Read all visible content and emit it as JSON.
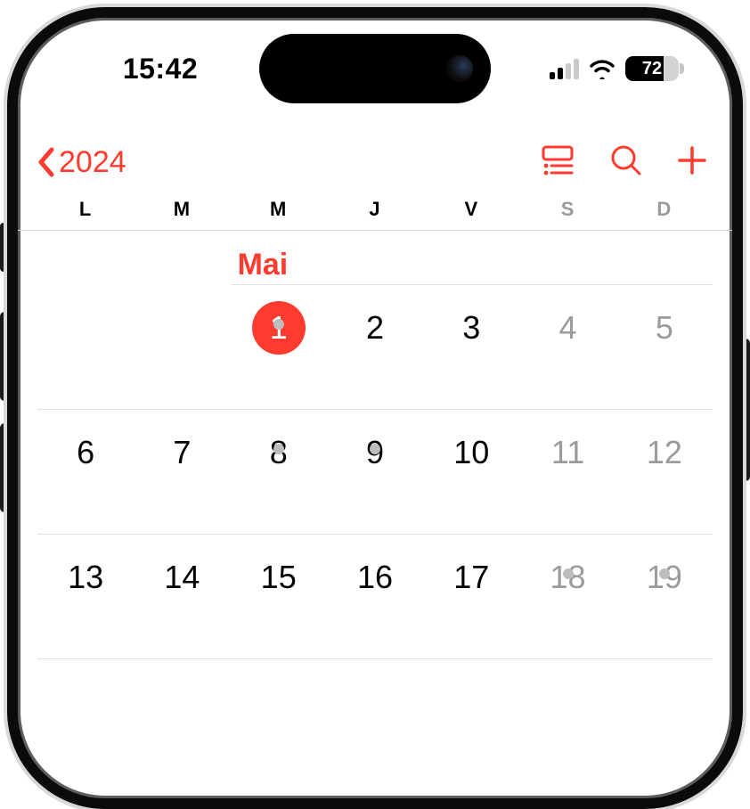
{
  "status": {
    "time": "15:42",
    "battery_pct": "72",
    "battery_fill_pct": 72,
    "signal_active_bars": 2
  },
  "nav": {
    "back_label": "2024"
  },
  "weekdays": [
    {
      "label": "L",
      "weekend": false
    },
    {
      "label": "M",
      "weekend": false
    },
    {
      "label": "M",
      "weekend": false
    },
    {
      "label": "J",
      "weekend": false
    },
    {
      "label": "V",
      "weekend": false
    },
    {
      "label": "S",
      "weekend": true
    },
    {
      "label": "D",
      "weekend": true
    }
  ],
  "month": {
    "label": "Mai",
    "label_col": 3
  },
  "weeks": [
    [
      {
        "n": "",
        "weekend": false,
        "today": false,
        "event": false
      },
      {
        "n": "",
        "weekend": false,
        "today": false,
        "event": false
      },
      {
        "n": "1",
        "weekend": false,
        "today": true,
        "event": true
      },
      {
        "n": "2",
        "weekend": false,
        "today": false,
        "event": false
      },
      {
        "n": "3",
        "weekend": false,
        "today": false,
        "event": false
      },
      {
        "n": "4",
        "weekend": true,
        "today": false,
        "event": false
      },
      {
        "n": "5",
        "weekend": true,
        "today": false,
        "event": false
      }
    ],
    [
      {
        "n": "6",
        "weekend": false,
        "today": false,
        "event": false
      },
      {
        "n": "7",
        "weekend": false,
        "today": false,
        "event": false
      },
      {
        "n": "8",
        "weekend": false,
        "today": false,
        "event": true
      },
      {
        "n": "9",
        "weekend": false,
        "today": false,
        "event": true
      },
      {
        "n": "10",
        "weekend": false,
        "today": false,
        "event": false
      },
      {
        "n": "11",
        "weekend": true,
        "today": false,
        "event": false
      },
      {
        "n": "12",
        "weekend": true,
        "today": false,
        "event": false
      }
    ],
    [
      {
        "n": "13",
        "weekend": false,
        "today": false,
        "event": false
      },
      {
        "n": "14",
        "weekend": false,
        "today": false,
        "event": false
      },
      {
        "n": "15",
        "weekend": false,
        "today": false,
        "event": false
      },
      {
        "n": "16",
        "weekend": false,
        "today": false,
        "event": false
      },
      {
        "n": "17",
        "weekend": false,
        "today": false,
        "event": false
      },
      {
        "n": "18",
        "weekend": true,
        "today": false,
        "event": true
      },
      {
        "n": "19",
        "weekend": true,
        "today": false,
        "event": true
      }
    ]
  ],
  "colors": {
    "accent": "#ff3b30"
  }
}
